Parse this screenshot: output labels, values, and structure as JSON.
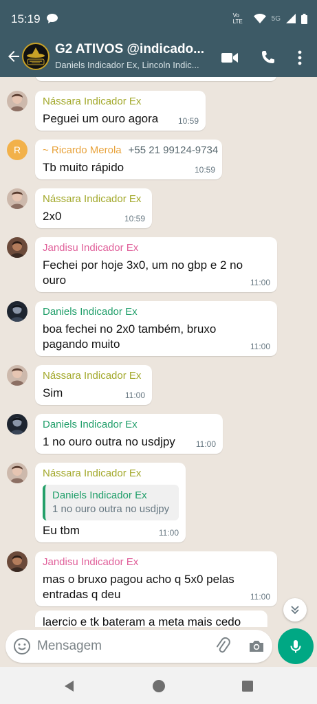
{
  "status_bar": {
    "time": "15:19",
    "network": "Vo LTE",
    "signal_label": "5G"
  },
  "header": {
    "title": "G2 ATIVOS @indicado...",
    "subtitle": "Daniels Indicador Ex, Lincoln Indic...",
    "avatar_logo_text": "INDICADOR BRUXO",
    "icons": [
      "back-arrow-icon",
      "video-call-icon",
      "voice-call-icon",
      "more-options-icon"
    ]
  },
  "messages": [
    {
      "sender": "Nássara Indicador Ex",
      "color": "#a2a82a",
      "text": "Peguei um ouro agora",
      "time": "10:59"
    },
    {
      "sender": "~ Ricardo Merola",
      "phone": "+55 21 99124-9734",
      "avatar_letter": "R",
      "color": "#e8a33c",
      "text": "Tb muito rápido",
      "time": "10:59"
    },
    {
      "sender": "Nássara Indicador Ex",
      "color": "#a2a82a",
      "text": "2x0",
      "time": "10:59"
    },
    {
      "sender": "Jandisu Indicador Ex",
      "color": "#e0609a",
      "lines": [
        "Fechei por hoje 3x0, um no gbp e 2 no",
        "ouro"
      ],
      "time": "11:00"
    },
    {
      "sender": "Daniels Indicador Ex",
      "color": "#1f9e69",
      "lines": [
        "boa fechei no 2x0 também, bruxo",
        "pagando muito"
      ],
      "time": "11:00"
    },
    {
      "sender": "Nássara Indicador Ex",
      "color": "#a2a82a",
      "text": "Sim",
      "time": "11:00"
    },
    {
      "sender": "Daniels Indicador Ex",
      "color": "#1f9e69",
      "text": "1 no ouro outra no usdjpy",
      "time": "11:00"
    },
    {
      "sender": "Nássara Indicador Ex",
      "color": "#a2a82a",
      "quote": {
        "sender": "Daniels Indicador Ex",
        "text": "1 no ouro outra no usdjpy"
      },
      "text": "Eu tbm",
      "time": "11:00"
    },
    {
      "sender": "Jandisu Indicador Ex",
      "color": "#e0609a",
      "lines": [
        "mas o bruxo pagou acho q 5x0 pelas",
        "entradas q deu"
      ],
      "time": "11:00"
    },
    {
      "text": "laercio e tk bateram a meta mais cedo"
    }
  ],
  "composer": {
    "placeholder": "Mensagem"
  },
  "colors": {
    "header": "#3d5a66",
    "chat_bg": "#ece5dd",
    "accent": "#00a884"
  }
}
